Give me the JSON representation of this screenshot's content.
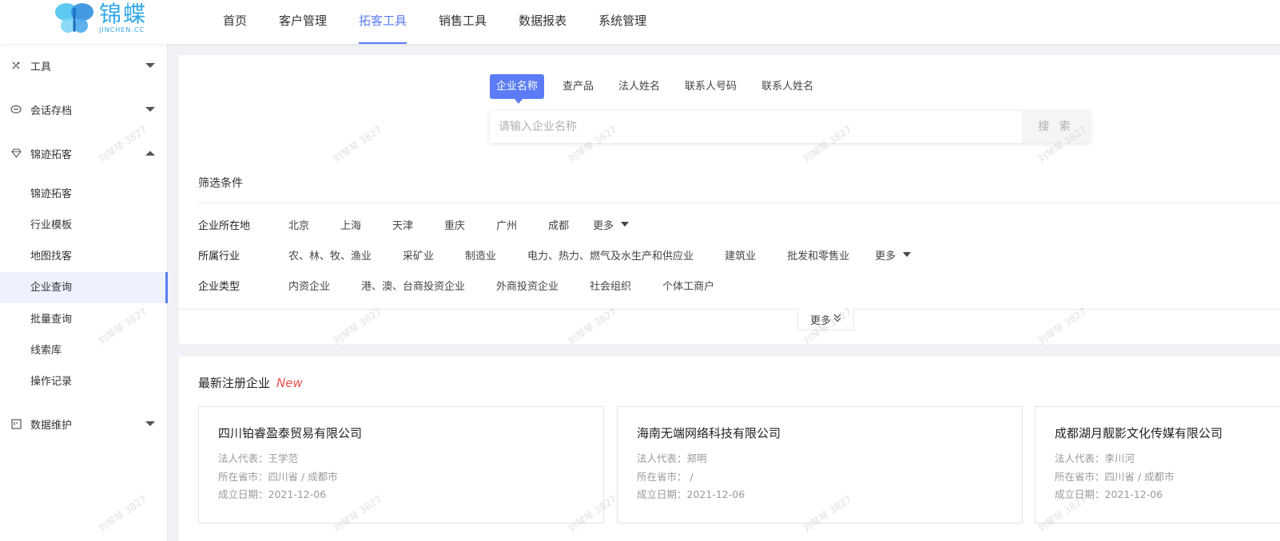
{
  "logo": {
    "cn": "锦蝶",
    "en": "JINCHEN.CC"
  },
  "top_nav": [
    {
      "label": "首页",
      "active": false
    },
    {
      "label": "客户管理",
      "active": false
    },
    {
      "label": "拓客工具",
      "active": true
    },
    {
      "label": "销售工具",
      "active": false
    },
    {
      "label": "数据报表",
      "active": false
    },
    {
      "label": "系统管理",
      "active": false
    }
  ],
  "sidebar": {
    "groups": [
      {
        "label": "工具",
        "icon": "tools-icon",
        "expanded": false
      },
      {
        "label": "会话存档",
        "icon": "chat-archive-icon",
        "expanded": false
      },
      {
        "label": "锦迹拓客",
        "icon": "diamond-icon",
        "expanded": true
      },
      {
        "label": "数据维护",
        "icon": "data-maintenance-icon",
        "expanded": false
      }
    ],
    "sub_items": [
      {
        "label": "锦迹拓客",
        "active": false
      },
      {
        "label": "行业模板",
        "active": false
      },
      {
        "label": "地图找客",
        "active": false
      },
      {
        "label": "企业查询",
        "active": true
      },
      {
        "label": "批量查询",
        "active": false
      },
      {
        "label": "线索库",
        "active": false
      },
      {
        "label": "操作记录",
        "active": false
      }
    ]
  },
  "search": {
    "tabs": [
      {
        "label": "企业名称",
        "active": true
      },
      {
        "label": "查产品",
        "active": false
      },
      {
        "label": "法人姓名",
        "active": false
      },
      {
        "label": "联系人号码",
        "active": false
      },
      {
        "label": "联系人姓名",
        "active": false
      }
    ],
    "placeholder": "请输入企业名称",
    "value": "",
    "button_label": "搜 索"
  },
  "filters": {
    "title": "筛选条件",
    "rows": [
      {
        "label": "企业所在地",
        "options": [
          "北京",
          "上海",
          "天津",
          "重庆",
          "广州",
          "成都"
        ],
        "more": "更多"
      },
      {
        "label": "所属行业",
        "options": [
          "农、林、牧、渔业",
          "采矿业",
          "制造业",
          "电力、热力、燃气及水生产和供应业",
          "建筑业",
          "批发和零售业"
        ],
        "more": "更多"
      },
      {
        "label": "企业类型",
        "options": [
          "内资企业",
          "港、澳、台商投资企业",
          "外商投资企业",
          "社会组织",
          "个体工商户"
        ],
        "more": ""
      }
    ],
    "expand_label": "更多"
  },
  "newest": {
    "title": "最新注册企业",
    "badge": "New",
    "cards": [
      {
        "name": "四川铂睿盈泰贸易有限公司",
        "legal": "法人代表：王学范",
        "location": "所在省市：四川省 / 成都市",
        "date": "成立日期：2021-12-06"
      },
      {
        "name": "海南无端网络科技有限公司",
        "legal": "法人代表：郑明",
        "location": "所在省市： /",
        "date": "成立日期：2021-12-06"
      },
      {
        "name": "成都湖月靓影文化传媒有限公司",
        "legal": "法人代表：李川河",
        "location": "所在省市：四川省 / 成都市",
        "date": "成立日期：2021-12-06"
      }
    ]
  },
  "watermark": "刘琴琴 3827",
  "colors": {
    "accent": "#5b7cf6",
    "new_badge": "#f0504b",
    "logo": "#2fa8e6"
  }
}
